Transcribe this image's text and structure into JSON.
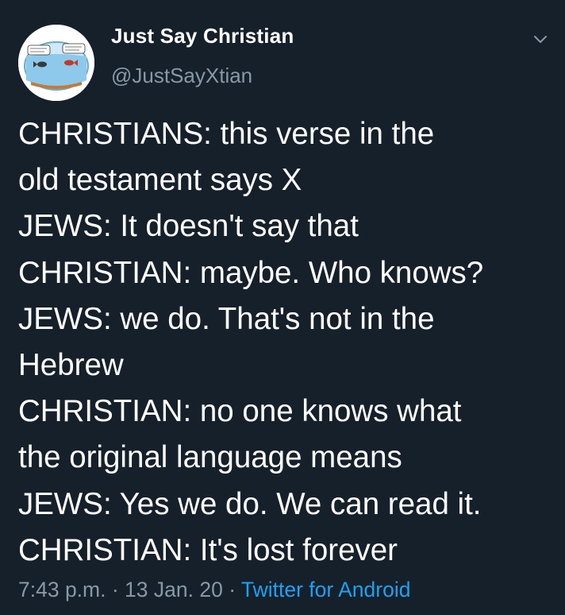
{
  "author": {
    "display_name": "Just Say Christian",
    "handle": "@JustSayXtian"
  },
  "tweet": {
    "lines": [
      "CHRISTIANS: this verse in the",
      "old testament says X",
      "JEWS: It doesn't say that",
      "CHRISTIAN: maybe. Who knows?",
      "JEWS: we do. That's not in the",
      "Hebrew",
      "CHRISTIAN: no one knows what",
      "the original language means",
      "JEWS: Yes we do. We can read it.",
      "CHRISTIAN: It's lost forever"
    ]
  },
  "meta": {
    "time": "7:43 p.m.",
    "sep1": " · ",
    "date": "13 Jan. 20",
    "sep2": " · ",
    "source": "Twitter for Android"
  },
  "icons": {
    "caret": "chevron-down-icon",
    "avatar": "fishbowl-avatar"
  },
  "colors": {
    "background": "#15202b",
    "primary_text": "#ffffff",
    "secondary_text": "#8899a6",
    "link": "#1da1f2"
  }
}
